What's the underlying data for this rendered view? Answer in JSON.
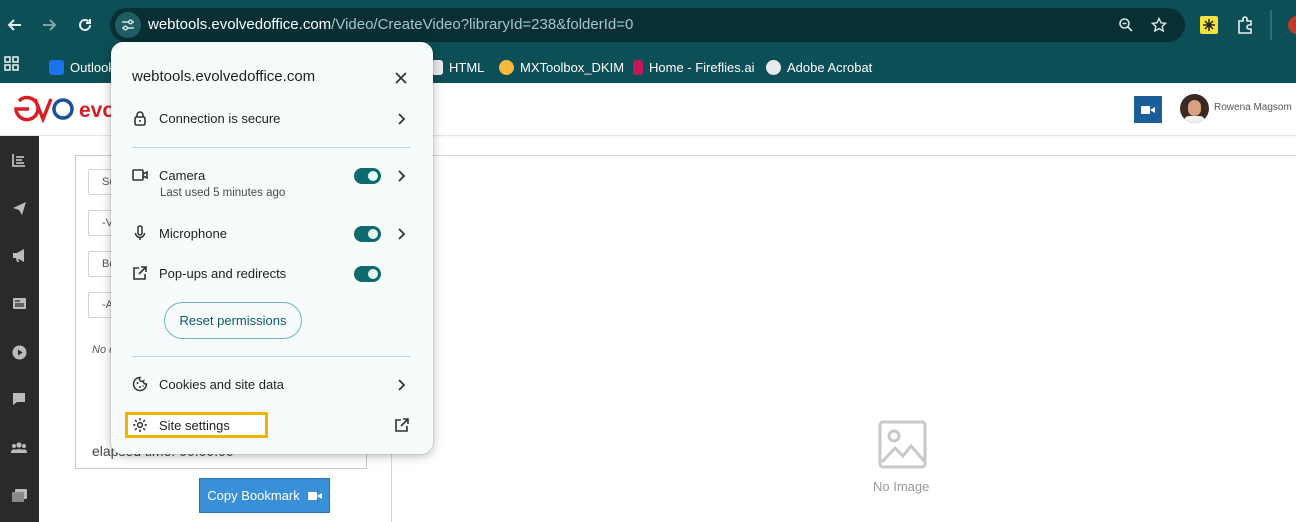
{
  "browser": {
    "url_host": "webtools.evolvedoffice.com",
    "url_path": "/Video/CreateVideo?libraryId=238&folderId=0",
    "bookmarks": [
      {
        "label": "Outlook",
        "color": "#1a73e8"
      },
      {
        "label": "HTML",
        "color": "#e8eaed"
      },
      {
        "label": "MXToolbox_DKIM",
        "color": "#f6b93b"
      },
      {
        "label": "Home - Fireflies.ai",
        "color": "#c2185b"
      },
      {
        "label": "Adobe Acrobat",
        "color": "#e8eaed"
      }
    ]
  },
  "app": {
    "logo_text": "evo",
    "user_name": "Rowena Magsom",
    "fields": [
      "So",
      "-V",
      "Bo",
      "-A"
    ],
    "no_label": "No c",
    "elapsed_text": "elapsed time: 00:00:00",
    "copy_button_label": "Copy Bookmark",
    "no_image_label": "No Image"
  },
  "popup": {
    "title": "webtools.evolvedoffice.com",
    "connection_label": "Connection is secure",
    "camera_label": "Camera",
    "camera_sub": "Last used 5 minutes ago",
    "camera_enabled": true,
    "microphone_label": "Microphone",
    "microphone_enabled": true,
    "popups_label": "Pop-ups and redirects",
    "popups_enabled": true,
    "reset_label": "Reset permissions",
    "cookies_label": "Cookies and site data",
    "site_settings_label": "Site settings"
  },
  "colors": {
    "chrome_bg": "#0d4f57",
    "toggle_on": "#0d6b6d",
    "highlight": "#f0b400",
    "brand_red": "#d81f26",
    "brand_blue": "#1b4f9c"
  }
}
